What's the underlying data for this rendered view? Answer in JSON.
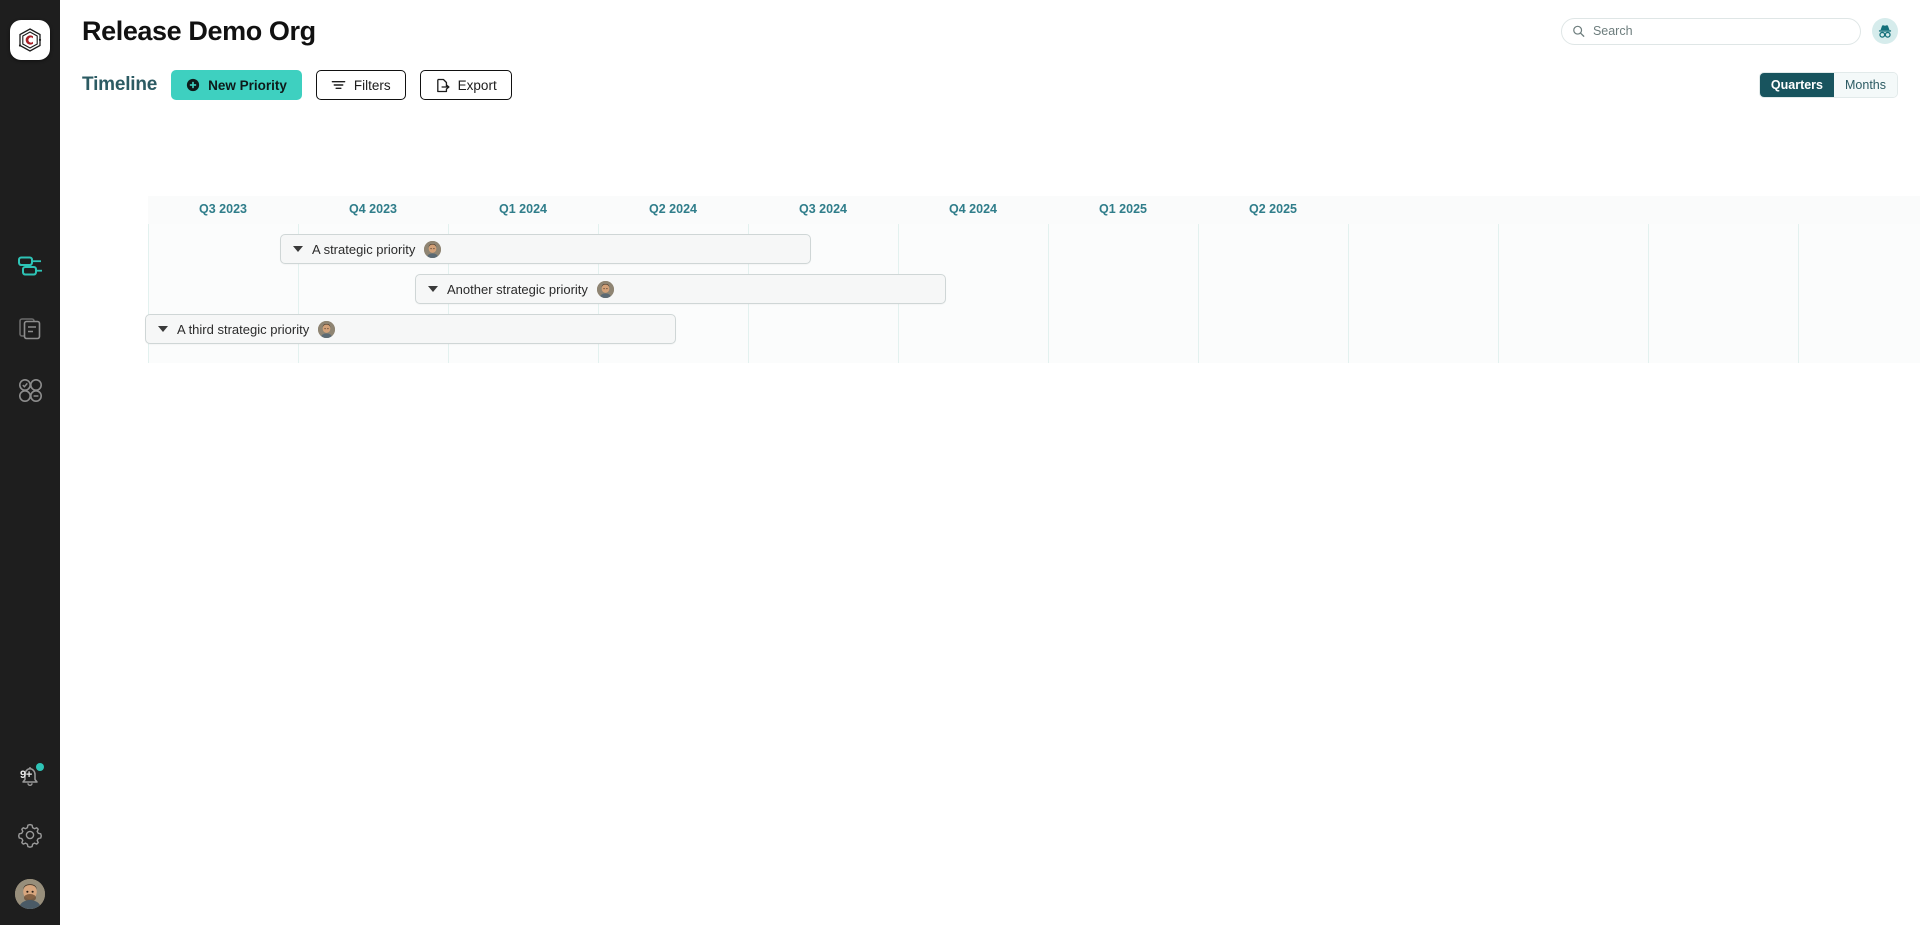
{
  "app": {
    "logo_icon": "hexagon-c-logo",
    "rail_items": [
      {
        "icon": "timeline-roadmap-icon",
        "name": "roadmap",
        "active": true
      },
      {
        "icon": "documents-stack-icon",
        "name": "documents",
        "active": false
      },
      {
        "icon": "circles-grid-icon",
        "name": "objectives",
        "active": false
      }
    ],
    "rail_bottom": [
      {
        "icon": "bell-icon",
        "name": "notifications",
        "badge": "9+",
        "dot": true
      },
      {
        "icon": "gear-icon",
        "name": "settings"
      },
      {
        "icon": "avatar-icon",
        "name": "user-avatar"
      }
    ]
  },
  "header": {
    "title": "Release Demo Org",
    "search": {
      "value": "",
      "placeholder": "Search",
      "icon": "search-icon"
    },
    "incognito_icon": "incognito-icon"
  },
  "toolbar": {
    "view_title": "Timeline",
    "new_priority_label": "New Priority",
    "new_priority_icon": "plus-circle-icon",
    "filters_label": "Filters",
    "filters_icon": "filter-icon",
    "export_label": "Export",
    "export_icon": "export-document-icon",
    "scale_options": [
      {
        "label": "Quarters",
        "active": true
      },
      {
        "label": "Months",
        "active": false
      }
    ]
  },
  "timeline": {
    "column_labels": [
      "Q3 2023",
      "Q4 2023",
      "Q1 2024",
      "Q2 2024",
      "Q3 2024",
      "Q4 2024",
      "Q1 2025",
      "Q2 2025"
    ],
    "column_count": 13,
    "rows": [
      {
        "label": "A strategic priority",
        "caret": "caret-down-icon",
        "avatar": "owner-avatar",
        "start_col": 0.88,
        "end_col": 4.42,
        "row_index": 0
      },
      {
        "label": "Another strategic priority",
        "caret": "caret-down-icon",
        "avatar": "owner-avatar",
        "start_col": 1.78,
        "end_col": 5.32,
        "row_index": 1
      },
      {
        "label": "A third strategic priority",
        "caret": "caret-down-icon",
        "avatar": "owner-avatar",
        "start_col": -0.02,
        "end_col": 3.52,
        "row_index": 2
      }
    ]
  },
  "colors": {
    "accent_teal": "#3ed0c0",
    "deep_teal": "#18545e",
    "label_teal": "#2f7d8a",
    "rail_bg": "#1e1e1e",
    "gridline": "#e3f1ef"
  }
}
